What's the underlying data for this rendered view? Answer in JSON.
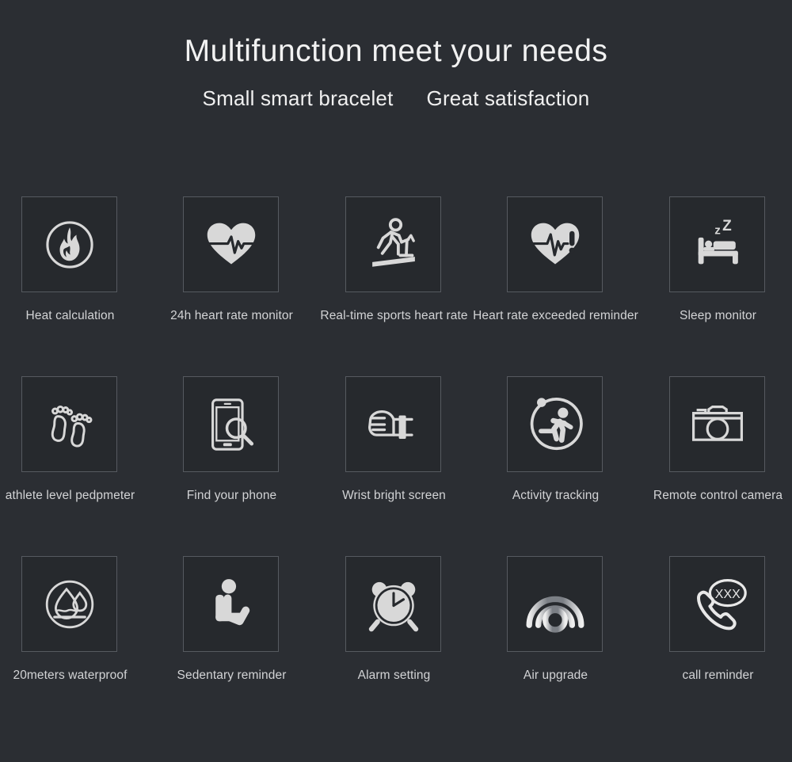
{
  "headings": {
    "title": "Multifunction meet your needs",
    "subtitle_left": "Small smart bracelet",
    "subtitle_right": "Great satisfaction"
  },
  "colors": {
    "background": "#2b2e33",
    "tile_fill": "#26292d",
    "tile_border": "#565a60",
    "icon": "#d8d8d8",
    "title_text": "#f2f2f2",
    "label_text": "#d2d3d5"
  },
  "features": [
    [
      {
        "label": "Heat calculation",
        "icon": "flame-in-circle-icon"
      },
      {
        "label": "24h heart rate monitor",
        "icon": "heart-pulse-icon"
      },
      {
        "label": "Real-time sports heart rate",
        "icon": "treadmill-runner-icon"
      },
      {
        "label": "Heart rate exceeded reminder",
        "icon": "heart-pulse-alert-icon"
      },
      {
        "label": "Sleep monitor",
        "icon": "bed-sleep-icon"
      }
    ],
    [
      {
        "label": "athlete level pedpmeter",
        "icon": "footprints-icon"
      },
      {
        "label": "Find your phone",
        "icon": "phone-search-icon"
      },
      {
        "label": "Wrist bright screen",
        "icon": "wrist-fist-icon"
      },
      {
        "label": "Activity tracking",
        "icon": "runner-in-circle-icon"
      },
      {
        "label": "Remote control camera",
        "icon": "camera-icon"
      }
    ],
    [
      {
        "label": "20meters waterproof",
        "icon": "waterdrop-in-circle-icon"
      },
      {
        "label": "Sedentary reminder",
        "icon": "seated-person-icon"
      },
      {
        "label": "Alarm setting",
        "icon": "alarm-clock-icon"
      },
      {
        "label": "Air upgrade",
        "icon": "radio-waves-icon"
      },
      {
        "label": "call reminder",
        "icon": "phone-call-bubble-icon",
        "bubble_text": "XXX"
      }
    ]
  ]
}
